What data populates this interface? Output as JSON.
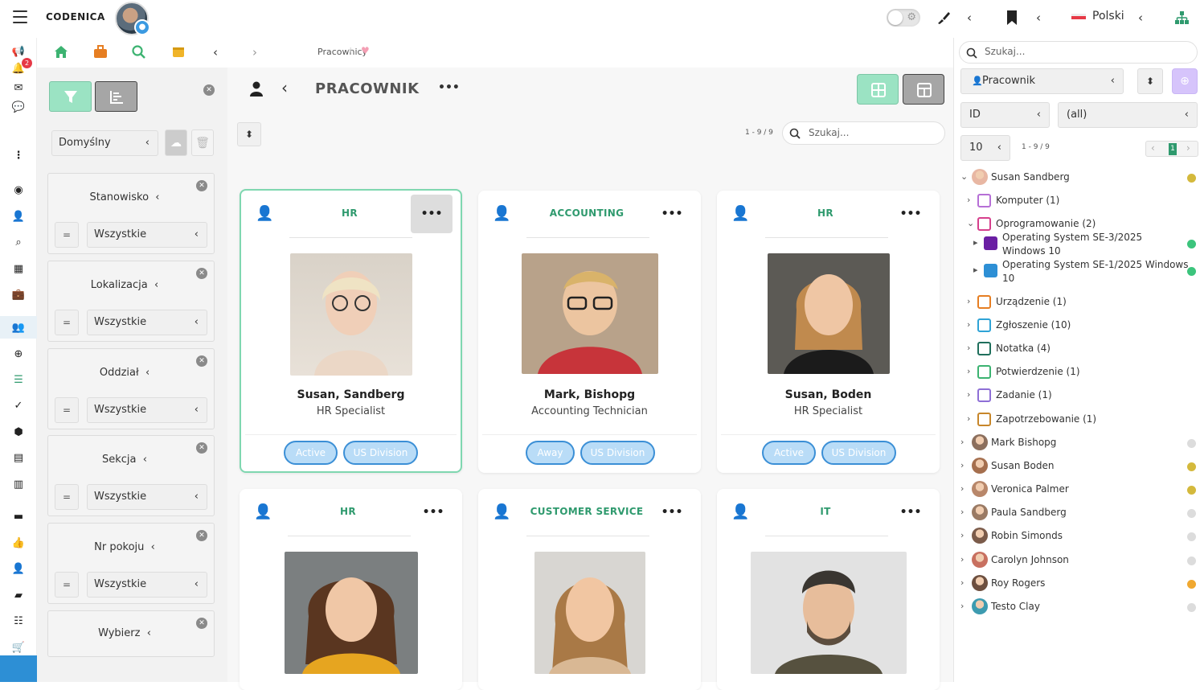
{
  "app": {
    "brand": "CODENICA",
    "language": "Polski",
    "notif_count": "2"
  },
  "breadcrumb": {
    "page": "Pracownicy"
  },
  "filters": {
    "preset": "Domyślny",
    "groups": [
      {
        "label": "Stanowisko",
        "value": "Wszystkie",
        "op": "="
      },
      {
        "label": "Lokalizacja",
        "value": "Wszystkie",
        "op": "="
      },
      {
        "label": "Oddział",
        "value": "Wszystkie",
        "op": "="
      },
      {
        "label": "Sekcja",
        "value": "Wszystkie",
        "op": "="
      },
      {
        "label": "Nr pokoju",
        "value": "Wszystkie",
        "op": "="
      },
      {
        "label": "Wybierz",
        "value": "",
        "op": ""
      }
    ]
  },
  "main": {
    "title": "PRACOWNIK",
    "pagination": "1 - 9 / 9",
    "search_placeholder": "Szukaj...",
    "cards": [
      {
        "dept": "HR",
        "name": "Susan, Sandberg",
        "role": "HR Specialist",
        "status": "Active",
        "division": "US Division"
      },
      {
        "dept": "ACCOUNTING",
        "name": "Mark, Bishopg",
        "role": "Accounting Technician",
        "status": "Away",
        "division": "US Division"
      },
      {
        "dept": "HR",
        "name": "Susan, Boden",
        "role": "HR Specialist",
        "status": "Active",
        "division": "US Division"
      },
      {
        "dept": "HR",
        "name": "",
        "role": "",
        "status": "",
        "division": ""
      },
      {
        "dept": "CUSTOMER SERVICE",
        "name": "",
        "role": "",
        "status": "",
        "division": ""
      },
      {
        "dept": "IT",
        "name": "",
        "role": "",
        "status": "",
        "division": ""
      }
    ]
  },
  "right": {
    "search_placeholder": "Szukaj...",
    "entity": "Pracownik",
    "field": "ID",
    "field_value": "(all)",
    "page_size": "10",
    "pagination": "1 - 9 / 9",
    "page": "1",
    "tree": [
      {
        "label": "Susan Sandberg",
        "level": 0,
        "dot": "#d4b93c"
      },
      {
        "label": "Komputer (1)",
        "level": 1,
        "dot": ""
      },
      {
        "label": "Oprogramowanie (2)",
        "level": 1,
        "dot": ""
      },
      {
        "label": "Operating System SE-3/2025",
        "label2": "Windows 10",
        "level": 2,
        "dot": "#3cc47c"
      },
      {
        "label": "Operating System SE-1/2025 Windows",
        "label2": "10",
        "level": 2,
        "dot": "#3cc47c"
      },
      {
        "label": "Urządzenie (1)",
        "level": 1,
        "dot": ""
      },
      {
        "label": "Zgłoszenie (10)",
        "level": 1,
        "dot": ""
      },
      {
        "label": "Notatka (4)",
        "level": 1,
        "dot": ""
      },
      {
        "label": "Potwierdzenie (1)",
        "level": 1,
        "dot": ""
      },
      {
        "label": "Zadanie (1)",
        "level": 1,
        "dot": ""
      },
      {
        "label": "Zapotrzebowanie (1)",
        "level": 1,
        "dot": ""
      },
      {
        "label": "Mark Bishopg",
        "level": 0,
        "dot": "#dcdcdc"
      },
      {
        "label": "Susan Boden",
        "level": 0,
        "dot": "#d4b93c"
      },
      {
        "label": "Veronica Palmer",
        "level": 0,
        "dot": "#d4b93c"
      },
      {
        "label": "Paula Sandberg",
        "level": 0,
        "dot": "#dcdcdc"
      },
      {
        "label": "Robin Simonds",
        "level": 0,
        "dot": "#dcdcdc"
      },
      {
        "label": "Carolyn Johnson",
        "level": 0,
        "dot": "#dcdcdc"
      },
      {
        "label": "Roy Rogers",
        "level": 0,
        "dot": "#f0a830"
      },
      {
        "label": "Testo Clay",
        "level": 0,
        "dot": "#dcdcdc"
      }
    ]
  },
  "colors": {
    "accent_green": "#2f9a6e",
    "accent_blue": "#3b8fd6",
    "selected_border": "#7fd7b0"
  }
}
